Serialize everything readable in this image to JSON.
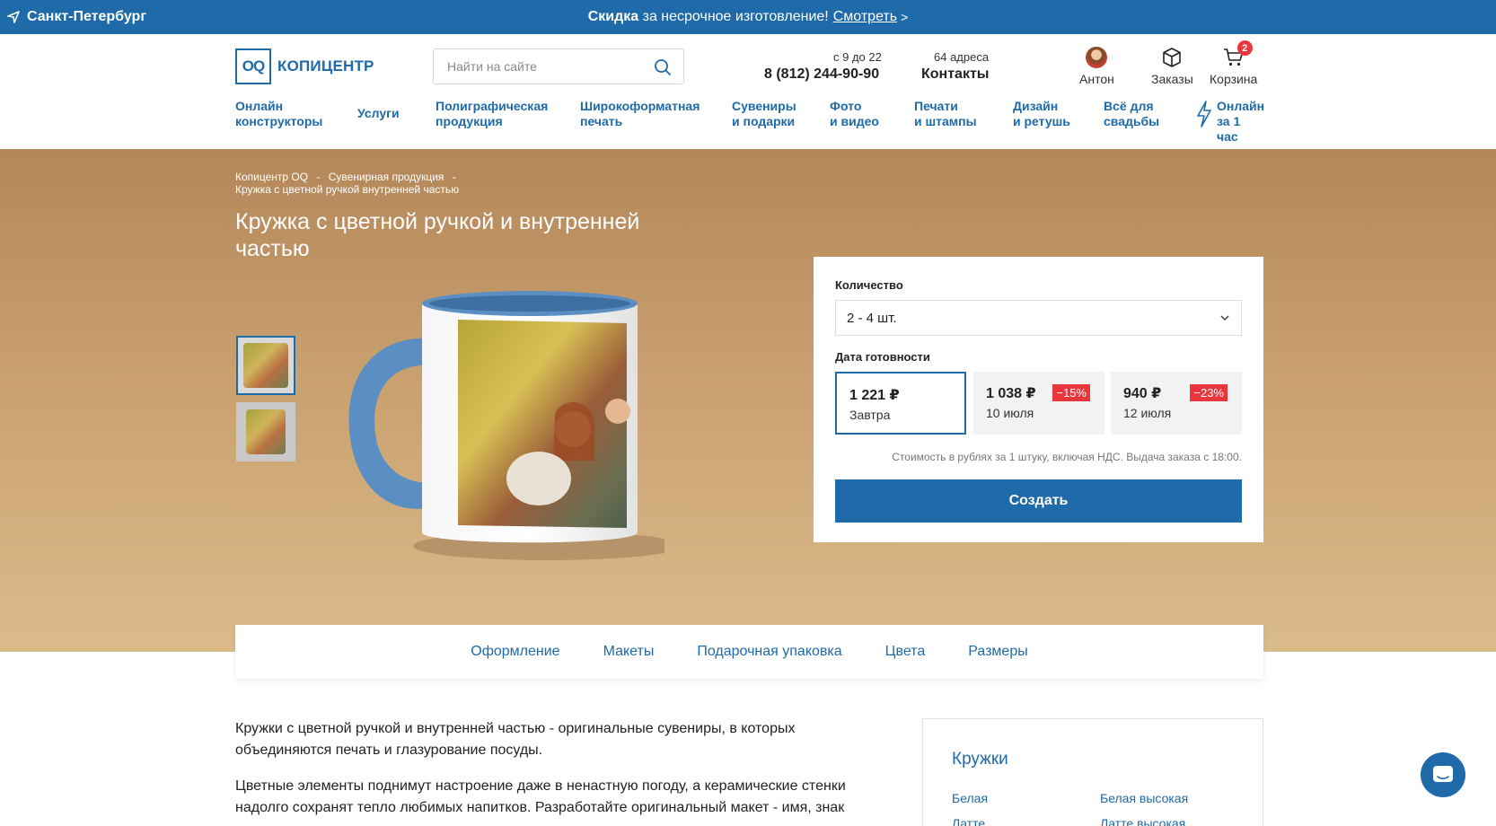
{
  "topbar": {
    "city": "Санкт-Петербург",
    "promo_bold": "Скидка",
    "promo_text": " за несрочное изготовление!",
    "promo_link": "Смотреть",
    "promo_arrow": ">"
  },
  "header": {
    "logo_mark": "OQ",
    "logo_text": "КОПИЦЕНТР",
    "search_placeholder": "Найти на сайте",
    "hours": "с 9 до 22",
    "phone": "8 (812) 244-90-90",
    "addresses": "64 адреса",
    "contacts": "Контакты",
    "user_name": "Антон",
    "orders": "Заказы",
    "cart": "Корзина",
    "cart_count": "2"
  },
  "nav": [
    {
      "l1": "Онлайн",
      "l2": "конструкторы"
    },
    {
      "l1": "Услуги",
      "l2": ""
    },
    {
      "l1": "Полиграфическая",
      "l2": "продукция"
    },
    {
      "l1": "Широкоформатная",
      "l2": "печать"
    },
    {
      "l1": "Сувениры",
      "l2": "и подарки"
    },
    {
      "l1": "Фото",
      "l2": "и видео"
    },
    {
      "l1": "Печати",
      "l2": "и штампы"
    },
    {
      "l1": "Дизайн",
      "l2": "и ретушь"
    },
    {
      "l1": "Всё для",
      "l2": "свадьбы"
    },
    {
      "l1": "Онлайн",
      "l2": "за 1 час"
    }
  ],
  "breadcrumbs": {
    "c1": "Копицентр OQ",
    "c2": "Сувенирная продукция",
    "c3": "Кружка с цветной ручкой внутренней частью",
    "sep": "-"
  },
  "page_title": "Кружка с цветной ручкой и внутренней частью",
  "order": {
    "qty_label": "Количество",
    "qty_value": "2 - 4 шт.",
    "date_label": "Дата готовности",
    "options": [
      {
        "price": "1 221 ₽",
        "date": "Завтра",
        "discount": ""
      },
      {
        "price": "1 038 ₽",
        "date": "10 июля",
        "discount": "−15%"
      },
      {
        "price": "940 ₽",
        "date": "12 июля",
        "discount": "−23%"
      }
    ],
    "note": "Стоимость в рублях за 1 штуку, включая НДС. Выдача заказа с 18:00.",
    "create_label": "Создать"
  },
  "tabs": [
    "Оформление",
    "Макеты",
    "Подарочная упаковка",
    "Цвета",
    "Размеры"
  ],
  "content": {
    "p1_l1": "Кружки с цветной ручкой и внутренней частью - оригинальные сувениры, в которых",
    "p1_l2": "объединяются печать и глазурование посуды.",
    "p2_l1": "Цветные элементы поднимут настроение даже в ненастную погоду, а керамические стенки",
    "p2_l2": "надолго сохранят тепло любимых напитков. Разработайте оригинальный макет - имя, знак"
  },
  "sidebar": {
    "title": "Кружки",
    "links": [
      "Белая",
      "Белая высокая",
      "Латте",
      "Латте высокая"
    ]
  },
  "colors": {
    "brand": "#1f6aa8",
    "discount": "#e8363c",
    "hero_top": "#b48759",
    "hero_bottom": "#dcbb8b"
  }
}
